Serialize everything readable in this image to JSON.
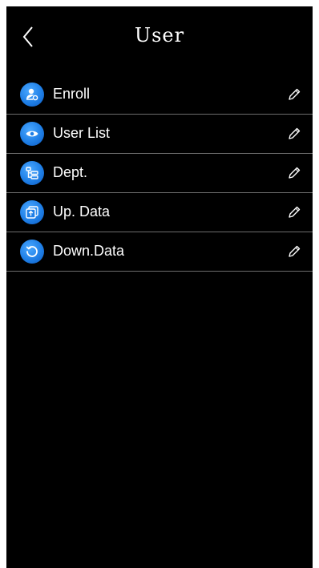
{
  "header": {
    "title": "User",
    "back_icon": "chevron-left-icon"
  },
  "menu": {
    "items": [
      {
        "label": "Enroll",
        "icon": "user-add-icon",
        "action_icon": "pencil-icon"
      },
      {
        "label": "User List",
        "icon": "eye-icon",
        "action_icon": "pencil-icon"
      },
      {
        "label": "Dept.",
        "icon": "org-tree-icon",
        "action_icon": "pencil-icon"
      },
      {
        "label": "Up. Data",
        "icon": "upload-data-icon",
        "action_icon": "pencil-icon"
      },
      {
        "label": "Down.Data",
        "icon": "refresh-download-icon",
        "action_icon": "pencil-icon"
      }
    ]
  },
  "colors": {
    "background": "#000000",
    "text": "#ffffff",
    "icon_blue": "#1f7fe6",
    "divider": "#6e6e6e"
  }
}
